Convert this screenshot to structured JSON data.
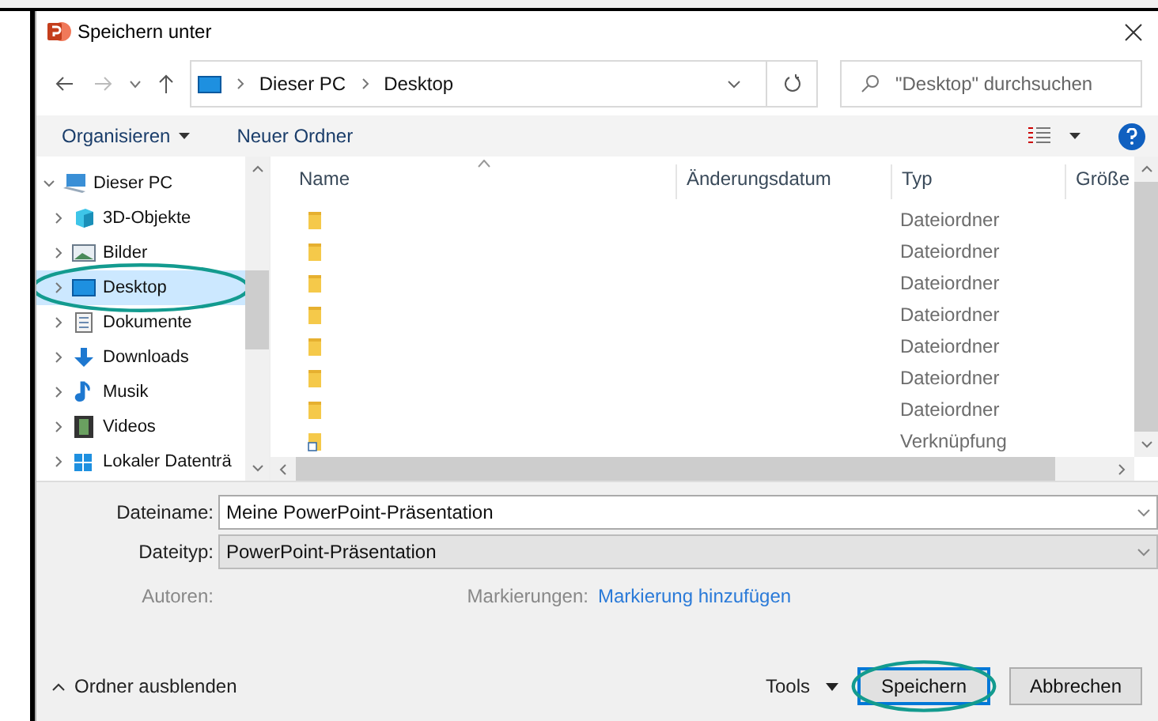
{
  "window": {
    "title": "Speichern unter"
  },
  "address": {
    "path": [
      "Dieser PC",
      "Desktop"
    ]
  },
  "search": {
    "placeholder": "\"Desktop\" durchsuchen"
  },
  "toolbar": {
    "organize": "Organisieren",
    "new_folder": "Neuer Ordner"
  },
  "tree": [
    {
      "label": "Dieser PC",
      "kind": "pc",
      "expanded": true,
      "selected": false,
      "annotated": false,
      "children": [
        {
          "label": "3D-Objekte",
          "kind": "cube",
          "expanded": false,
          "selected": false,
          "annotated": false
        },
        {
          "label": "Bilder",
          "kind": "pictures",
          "expanded": false,
          "selected": false,
          "annotated": false
        },
        {
          "label": "Desktop",
          "kind": "desktop",
          "expanded": false,
          "selected": true,
          "annotated": true
        },
        {
          "label": "Dokumente",
          "kind": "documents",
          "expanded": false,
          "selected": false,
          "annotated": false
        },
        {
          "label": "Downloads",
          "kind": "downloads",
          "expanded": false,
          "selected": false,
          "annotated": false
        },
        {
          "label": "Musik",
          "kind": "music",
          "expanded": false,
          "selected": false,
          "annotated": false
        },
        {
          "label": "Videos",
          "kind": "videos",
          "expanded": false,
          "selected": false,
          "annotated": false
        },
        {
          "label": "Lokaler Datenträ",
          "kind": "drive",
          "expanded": false,
          "selected": false,
          "annotated": false
        }
      ]
    }
  ],
  "table": {
    "columns": [
      "Name",
      "Änderungsdatum",
      "Typ",
      "Größe"
    ],
    "rows": [
      {
        "kind": "folder",
        "type": "Dateiordner"
      },
      {
        "kind": "folder",
        "type": "Dateiordner"
      },
      {
        "kind": "folder",
        "type": "Dateiordner"
      },
      {
        "kind": "folder",
        "type": "Dateiordner"
      },
      {
        "kind": "folder",
        "type": "Dateiordner"
      },
      {
        "kind": "folder",
        "type": "Dateiordner"
      },
      {
        "kind": "folder",
        "type": "Dateiordner"
      },
      {
        "kind": "shortcut",
        "type": "Verknüpfung"
      }
    ]
  },
  "form": {
    "filename_label": "Dateiname:",
    "filename": "Meine PowerPoint-Präsentation",
    "filetype_label": "Dateityp:",
    "filetype": "PowerPoint-Präsentation",
    "authors_label": "Autoren:",
    "tags_label": "Markierungen:",
    "tags_link": "Markierung hinzufügen"
  },
  "footer": {
    "hide_folders": "Ordner ausblenden",
    "tools": "Tools",
    "buttons": [
      {
        "label": "Speichern",
        "kind": "primary",
        "annotated": true
      },
      {
        "label": "Abbrechen",
        "kind": "secondary",
        "annotated": false
      }
    ]
  }
}
